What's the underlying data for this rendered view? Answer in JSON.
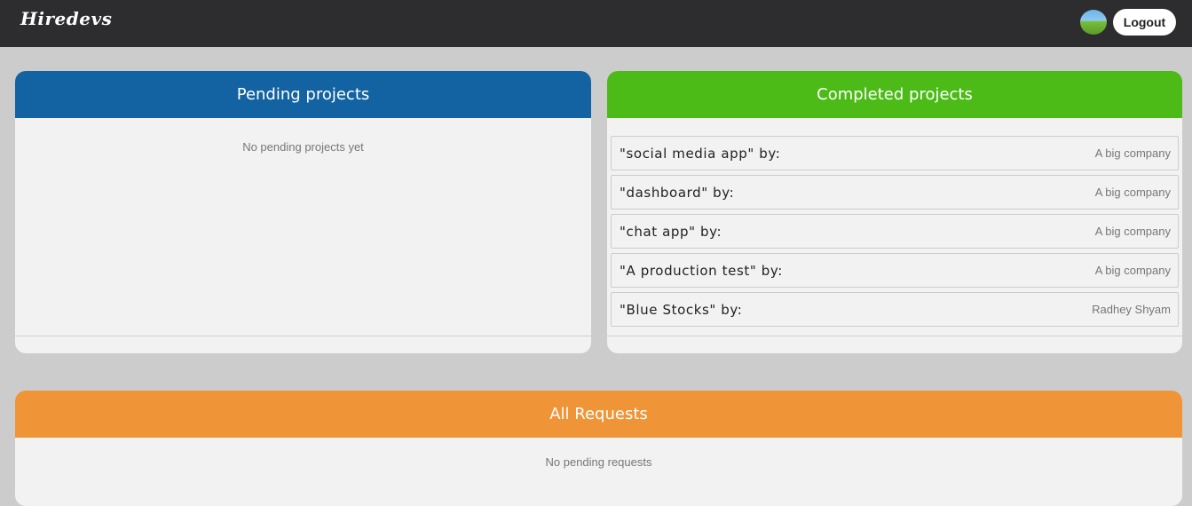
{
  "nav": {
    "brand": "Hiredevs",
    "logout_label": "Logout"
  },
  "pending": {
    "title": "Pending projects",
    "empty_text": "No pending projects yet"
  },
  "completed": {
    "title": "Completed projects",
    "items": [
      {
        "name": "\"social media app\" by:",
        "company": "A big company"
      },
      {
        "name": "\"dashboard\" by:",
        "company": "A big company"
      },
      {
        "name": "\"chat app\" by:",
        "company": "A big company"
      },
      {
        "name": "\"A production test\" by:",
        "company": "A big company"
      },
      {
        "name": "\"Blue Stocks\" by:",
        "company": "Radhey Shyam"
      }
    ]
  },
  "requests": {
    "title": "All Requests",
    "empty_text": "No pending requests"
  },
  "colors": {
    "navbar": "#2d2d2f",
    "pending_header": "#1362a1",
    "completed_header": "#4cbb17",
    "requests_header": "#f09438",
    "background": "#cccccc"
  }
}
